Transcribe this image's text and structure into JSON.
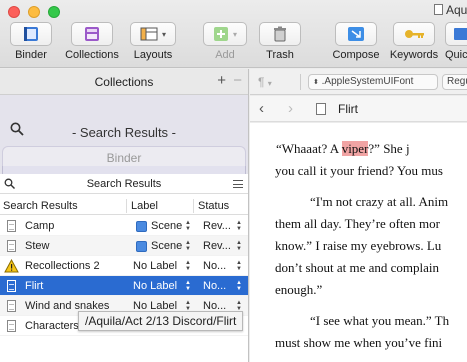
{
  "window": {
    "title": "Aquila"
  },
  "toolbar": {
    "binder": "Binder",
    "collections": "Collections",
    "layouts": "Layouts",
    "add": "Add",
    "trash": "Trash",
    "compose": "Compose",
    "keywords": "Keywords",
    "quick": "Quic"
  },
  "collections_panel": {
    "header": "Collections",
    "plus": "+",
    "minus": "−",
    "tab_search_label": "- Search Results -",
    "tab_binder_label": "Binder"
  },
  "search_results": {
    "title": "Search Results",
    "columns": {
      "title": "Search Results",
      "label": "Label",
      "status": "Status"
    },
    "rows": [
      {
        "title": "Camp",
        "label": "Scene",
        "status": "Rev..."
      },
      {
        "title": "Stew",
        "label": "Scene",
        "status": "Rev..."
      },
      {
        "title": "Recollections 2",
        "label": "No Label",
        "status": "No..."
      },
      {
        "title": "Flirt",
        "label": "No Label",
        "status": "No..."
      },
      {
        "title": "Wind and snakes",
        "label": "No Label",
        "status": "No..."
      },
      {
        "title": "Characters",
        "label": "",
        "status": ""
      }
    ],
    "tooltip": "/Aquila/Act 2/13 Discord/Flirt"
  },
  "format_bar": {
    "paragraph_symbol": "¶",
    "font": ".AppleSystemUIFont",
    "style": "Regular"
  },
  "editor": {
    "doc_title": "Flirt",
    "lines": [
      {
        "a": "“Whaaat? A ",
        "hl": "viper",
        "b": "?” She j"
      },
      {
        "a": "you call it your friend? You mus"
      },
      {
        "a": "“I'm not crazy at all. Anim"
      },
      {
        "a": "them all day. They’re often mor"
      },
      {
        "a": "know.” I raise my eyebrows. Lu"
      },
      {
        "a": "don’t shout at me and complain"
      },
      {
        "a": "enough.”"
      },
      {
        "a": "“I see what you mean.” Th"
      },
      {
        "a": "must show me when you’ve fini"
      }
    ]
  },
  "colors": {
    "selection": "#2a6bd1",
    "label_scene": "#4a8ae0",
    "highlight": "#f1a4a4"
  }
}
